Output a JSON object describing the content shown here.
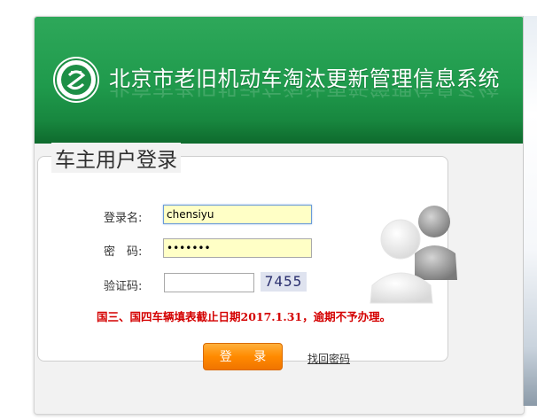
{
  "header": {
    "title": "北京市老旧机动车淘汰更新管理信息系统"
  },
  "login": {
    "heading": "车主用户登录",
    "username_label": "登录名:",
    "username_value": "chensiyu",
    "password_label": "密　码:",
    "password_value": "•••••••",
    "captcha_label": "验证码:",
    "captcha_value": "",
    "captcha_image_text": "7455",
    "notice": "国三、国四车辆填表截止日期2017.1.31，逾期不予办理。",
    "login_button": "登 录",
    "forgot_link": "找回密码"
  },
  "icons": {
    "logo": "shield-logo-icon",
    "avatar": "user-avatar-icon"
  },
  "colors": {
    "banner_green": "#1f9a4c",
    "notice_red": "#d40000",
    "button_orange": "#ff8a00",
    "field_yellow": "#ffffc6"
  }
}
